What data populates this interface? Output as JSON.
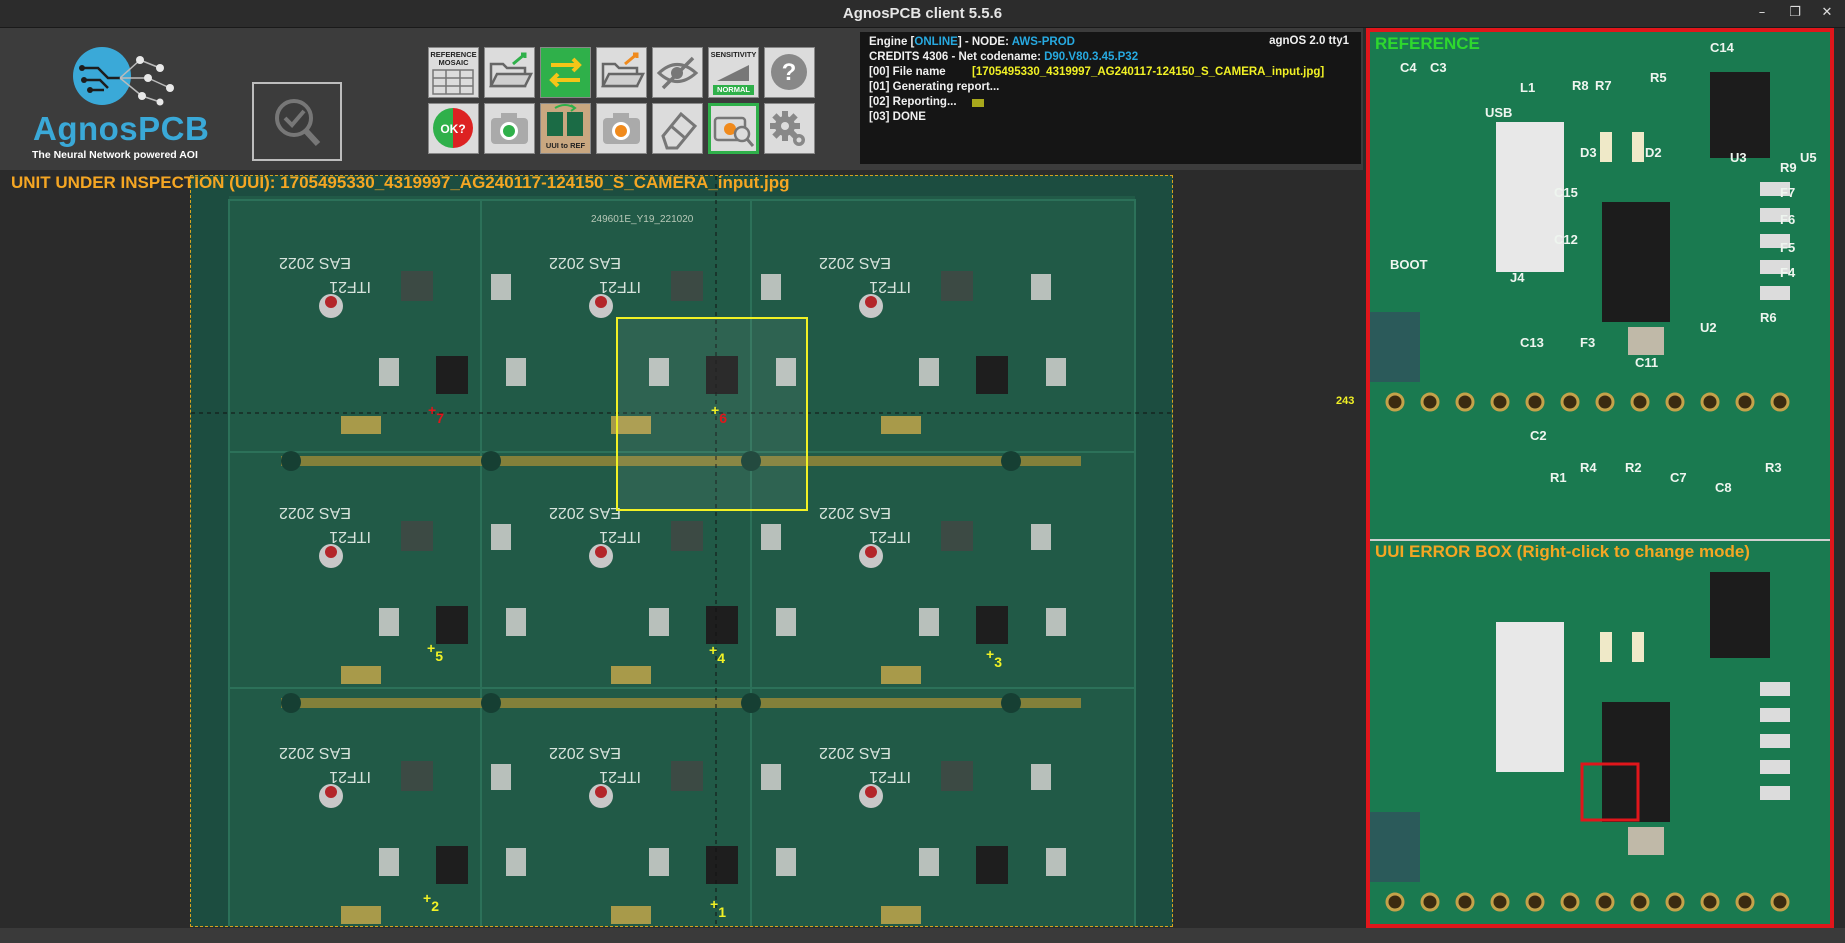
{
  "window": {
    "title": "AgnosPCB client 5.5.6",
    "min": "–",
    "max": "❐",
    "close": "✕"
  },
  "brand": {
    "name": "AgnosPCB",
    "tagline": "The Neural Network powered AOI"
  },
  "toolbar": {
    "reference_mosaic": "REFERENCE MOSAIC",
    "sensitivity": "SENSITIVITY",
    "sensitivity_level": "NORMAL",
    "ok": "OK?",
    "uui_to_ref": "UUI to REF",
    "help": "?"
  },
  "status": {
    "engine_prefix": "Engine [",
    "engine_state": "ONLINE",
    "engine_mid": "] - NODE: ",
    "node": "AWS-PROD",
    "os": "agnOS 2.0 tty1",
    "credits_prefix": "CREDITS 4306 - Net codename: ",
    "codename": "D90.V80.3.45.P32",
    "line0_label": "[00] File name",
    "line0_value": "[1705495330_4319997_AG240117-124150_S_CAMERA_input.jpg]",
    "line1": "[01] Generating report...",
    "line2": "[02] Reporting...",
    "line3": "[03] DONE"
  },
  "viewer": {
    "uui_title": "UNIT UNDER INSPECTION (UUI): 1705495330_4319997_AG240117-124150_S_CAMERA_input.jpg",
    "coord_readout": "243",
    "board_code": "249601E_Y19_221020",
    "silkscreen_model": "ITF21",
    "silkscreen_year": "EAS 2022",
    "markers": [
      "1",
      "2",
      "3",
      "4",
      "5",
      "6",
      "7"
    ]
  },
  "reference_panel": {
    "title": "REFERENCE",
    "labels": [
      "USB",
      "BOOT",
      "C15",
      "C12",
      "C13",
      "F3",
      "C11",
      "U2",
      "D3",
      "D2",
      "R7",
      "R8",
      "R5",
      "C14",
      "U3",
      "R9",
      "F7",
      "F6",
      "F5",
      "F4",
      "R6",
      "C2",
      "C3",
      "C4",
      "L1",
      "J4",
      "R1",
      "R4",
      "R2",
      "C7",
      "C8",
      "R3",
      "U5"
    ]
  },
  "error_panel": {
    "title": "UUI ERROR BOX (Right-click to change mode)"
  },
  "colors": {
    "accent_red": "#e0161b",
    "ref_green": "#2ed82e",
    "uui_orange": "#f5a623",
    "marker_yellow": "#f1f125",
    "marker_red": "#e0161b",
    "brand_blue": "#3aa9d8"
  }
}
